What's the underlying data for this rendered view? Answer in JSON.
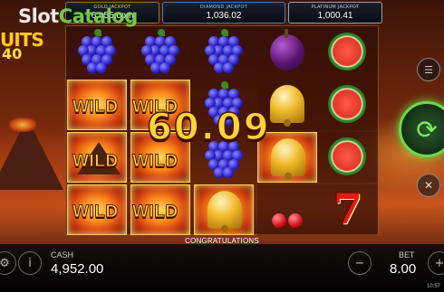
{
  "watermark": {
    "part1": "Slot",
    "part2": "Catalog"
  },
  "logo": {
    "line1": "",
    "line2": "UITS",
    "line3": "40"
  },
  "jackpots": {
    "gold": {
      "label": "GOLD JACKPOT",
      "value": "6,¤55.com"
    },
    "diamond": {
      "label": "DIAMOND JACKPOT",
      "value": "1,036.02"
    },
    "platinum": {
      "label": "PLATINUM JACKPOT",
      "value": "1,000.41"
    }
  },
  "reels": {
    "wild_label": "WILD",
    "symbols": [
      "grapes-icon",
      "plum-icon",
      "watermelon-icon",
      "bell-icon",
      "cherry-icon",
      "seven-icon",
      "volcano-icon"
    ]
  },
  "win": {
    "amount": "60.09"
  },
  "status": {
    "message": "CONGRATULATIONS"
  },
  "footer": {
    "cash_label": "CASH",
    "cash_value": "4,952.00",
    "bet_label": "BET",
    "bet_value": "8.00",
    "clock": "10:57"
  },
  "colors": {
    "accent_green": "#6adc4a",
    "wild_yellow": "#ffe24a",
    "win_gold": "#ffd43a"
  }
}
